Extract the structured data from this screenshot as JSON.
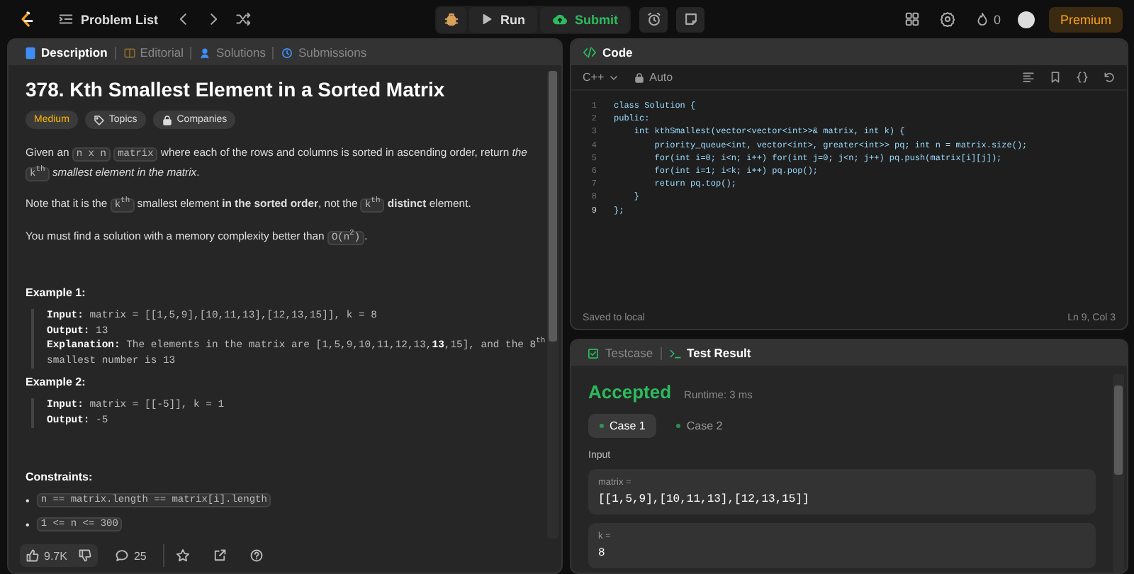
{
  "topbar": {
    "problem_list": "Problem List",
    "run": "Run",
    "submit": "Submit",
    "streak": "0",
    "premium": "Premium"
  },
  "description_tabs": [
    {
      "label": "Description",
      "selected": true
    },
    {
      "label": "Editorial",
      "selected": false
    },
    {
      "label": "Solutions",
      "selected": false
    },
    {
      "label": "Submissions",
      "selected": false
    }
  ],
  "problem": {
    "title": "378. Kth Smallest Element in a Sorted Matrix",
    "difficulty": "Medium",
    "topics": "Topics",
    "companies": "Companies",
    "paragraphs": [
      {
        "segments": [
          {
            "kind": "text",
            "text": "Given an "
          },
          {
            "kind": "code",
            "text": "n x n"
          },
          {
            "kind": "code",
            "text": "matrix"
          },
          {
            "kind": "text",
            "text": " where each of the rows and columns is sorted in ascending order, return *the* "
          },
          {
            "kind": "code",
            "text": "k$^{th}$"
          },
          {
            "kind": "text",
            "text": " *smallest element in the matrix*."
          }
        ]
      },
      {
        "segments": [
          {
            "kind": "text",
            "text": "Note that it is the "
          },
          {
            "kind": "code",
            "text": "k$^{th}$"
          },
          {
            "kind": "text",
            "text": " smallest element **in the sorted order**, not the "
          },
          {
            "kind": "code",
            "text": "k$^{th}$"
          },
          {
            "kind": "text",
            "text": " **distinct** element."
          }
        ]
      },
      {
        "segments": [
          {
            "kind": "text",
            "text": "You must find a solution with a memory complexity better than "
          },
          {
            "kind": "code",
            "text": "O(n$^{2}$)"
          },
          {
            "kind": "text",
            "text": "."
          }
        ]
      }
    ],
    "examples": [
      {
        "title": "Example 1:",
        "lines": [
          "**Input:** matrix = [[1,5,9],[10,11,13],[12,13,15]], k = 8",
          "**Output:** 13",
          "**Explanation:** The elements in the matrix are [1,5,9,10,11,12,13,**13**,15], and the 8$^{th}$ smallest number is 13"
        ]
      },
      {
        "title": "Example 2:",
        "lines": [
          "**Input:** matrix = [[-5]], k = 1",
          "**Output:** -5"
        ]
      }
    ],
    "constraints_title": "Constraints:",
    "constraints": [
      {
        "marker": "•",
        "text": "n == matrix.length == matrix[i].length"
      },
      {
        "marker": "•",
        "text": "1 <= n <= 300"
      }
    ]
  },
  "footer": {
    "likes": "9.7K",
    "comments": "25"
  },
  "editor": {
    "title": "Code",
    "language": "C++",
    "mode": "Auto",
    "lines": [
      {
        "number": "1",
        "code": "class Solution {",
        "active": false
      },
      {
        "number": "2",
        "code": "public:",
        "active": false
      },
      {
        "number": "3",
        "code": "    int kthSmallest(vector<vector<int>>& matrix, int k) {",
        "active": false
      },
      {
        "number": "4",
        "code": "        priority_queue<int, vector<int>, greater<int>> pq; int n = matrix.size();",
        "active": false
      },
      {
        "number": "5",
        "code": "        for(int i=0; i<n; i++) for(int j=0; j<n; j++) pq.push(matrix[i][j]);",
        "active": false
      },
      {
        "number": "6",
        "code": "        for(int i=1; i<k; i++) pq.pop();",
        "active": false
      },
      {
        "number": "7",
        "code": "        return pq.top();",
        "active": false
      },
      {
        "number": "8",
        "code": "    }",
        "active": false
      },
      {
        "number": "9",
        "code": "};",
        "active": true
      }
    ],
    "saved": "Saved to local",
    "cursor": "Ln 9, Col 3"
  },
  "result_tabs": [
    {
      "label": "Testcase",
      "selected": false
    },
    {
      "label": "Test Result",
      "selected": true
    }
  ],
  "result": {
    "status": "Accepted",
    "runtime": "Runtime: 3 ms",
    "cases": [
      {
        "label": "Case 1",
        "selected": true
      },
      {
        "label": "Case 2",
        "selected": false
      }
    ],
    "input_label": "Input",
    "inputs": [
      {
        "name": "matrix =",
        "value": "[[1,5,9],[10,11,13],[12,13,15]]"
      },
      {
        "name": "k =",
        "value": "8"
      }
    ]
  }
}
